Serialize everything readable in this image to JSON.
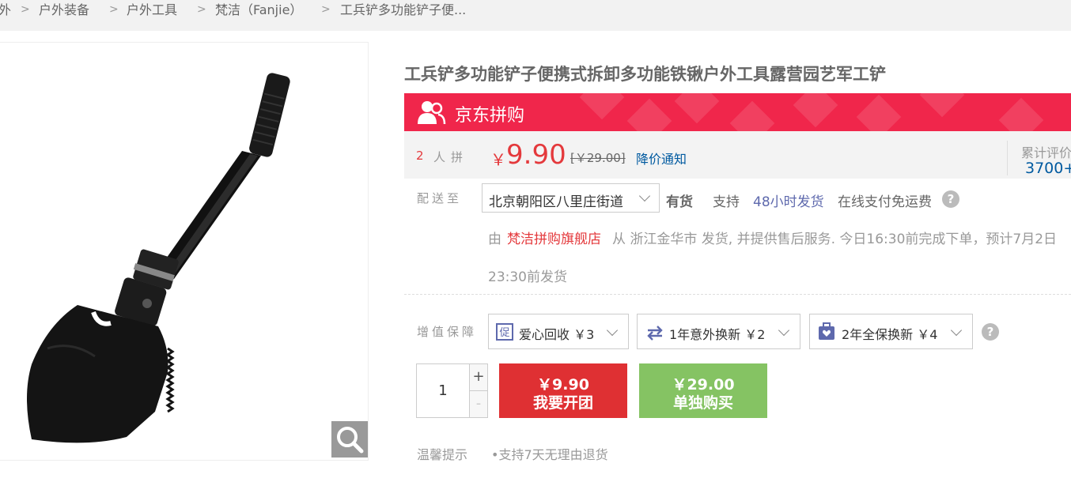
{
  "breadcrumb": {
    "items": [
      "外",
      "户外装备",
      "户外工具",
      "梵洁（Fanjie）",
      "工兵铲多功能铲子便..."
    ],
    "separator": ">"
  },
  "product": {
    "title": "工兵铲多功能铲子便携式拆卸多功能铁锹户外工具露营园艺军工铲",
    "image_desc": "folding shovel"
  },
  "pingou": {
    "title": "京东拼购",
    "people_count": "2",
    "people_label": "人拼",
    "currency": "￥",
    "price": "9.90",
    "old_price": "[￥29.00]",
    "notify": "降价通知",
    "review_label": "累计评价",
    "review_count": "3700+"
  },
  "delivery": {
    "label": "配送至",
    "address": "北京朝阳区八里庄街道",
    "stock": "有货",
    "support": "支持",
    "ship48": "48小时发货",
    "freeship": "在线支付免运费",
    "from": "由",
    "shop": "梵洁拼购旗舰店",
    "line1_rest": "从 浙江金华市 发货, 并提供售后服务. 今日16:30前完成下单，预计7月2日",
    "line2": "23:30前发货"
  },
  "services": {
    "label": "增值保障",
    "items": [
      {
        "label": "爱心回收 ￥3",
        "icon": "recycle-icon"
      },
      {
        "label": "1年意外换新 ￥2",
        "icon": "exchange-icon"
      },
      {
        "label": "2年全保换新 ￥4",
        "icon": "shield-box-icon"
      }
    ]
  },
  "purchase": {
    "quantity": "1",
    "plus": "+",
    "minus": "-",
    "group_price": "￥9.90",
    "group_label": "我要开团",
    "solo_price": "￥29.00",
    "solo_label": "单独购买"
  },
  "tips": {
    "label": "温馨提示",
    "items": [
      "•支持7天无理由退货"
    ]
  },
  "colors": {
    "accent_red": "#e4393c",
    "banner_red": "#f0264b",
    "link_blue": "#005aa0",
    "green": "#85c363"
  }
}
